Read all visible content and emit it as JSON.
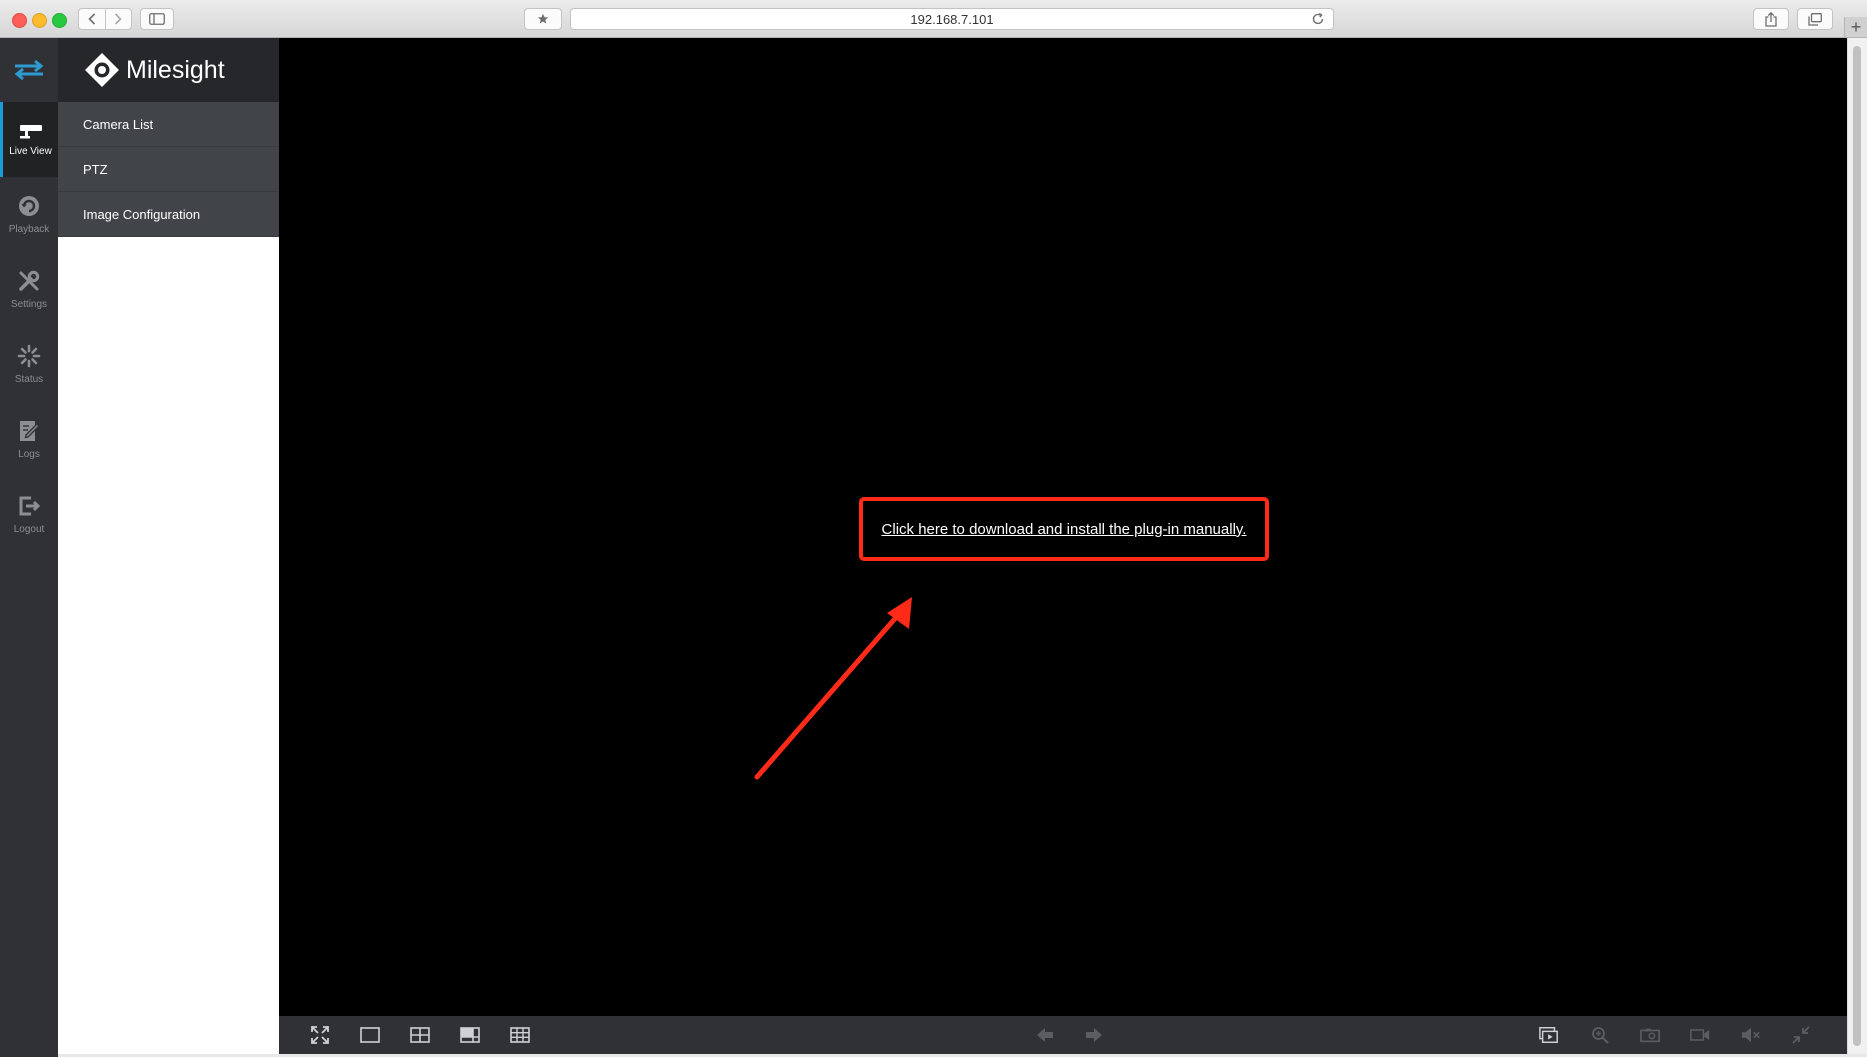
{
  "browser": {
    "url": "192.168.7.101",
    "new_tab_symbol": "+"
  },
  "brand": {
    "name": "Milesight"
  },
  "rail": {
    "items": [
      {
        "label": "Live View",
        "icon": "camera-icon",
        "active": true
      },
      {
        "label": "Playback",
        "icon": "playback-icon",
        "active": false
      },
      {
        "label": "Settings",
        "icon": "settings-icon",
        "active": false
      },
      {
        "label": "Status",
        "icon": "status-icon",
        "active": false
      },
      {
        "label": "Logs",
        "icon": "logs-icon",
        "active": false
      },
      {
        "label": "Logout",
        "icon": "logout-icon",
        "active": false
      }
    ]
  },
  "submenu": {
    "items": [
      {
        "label": "Camera List"
      },
      {
        "label": "PTZ"
      },
      {
        "label": "Image Configuration"
      }
    ]
  },
  "main": {
    "plugin_link": "Click here to download and install the plug-in manually."
  },
  "colors": {
    "rail_bg": "#2f3134",
    "panel_header_bg": "#25272a",
    "submenu_bg": "#414449",
    "active_accent": "#1e9bd7",
    "highlight_box": "#ff2a17",
    "video_bg": "#000000"
  }
}
